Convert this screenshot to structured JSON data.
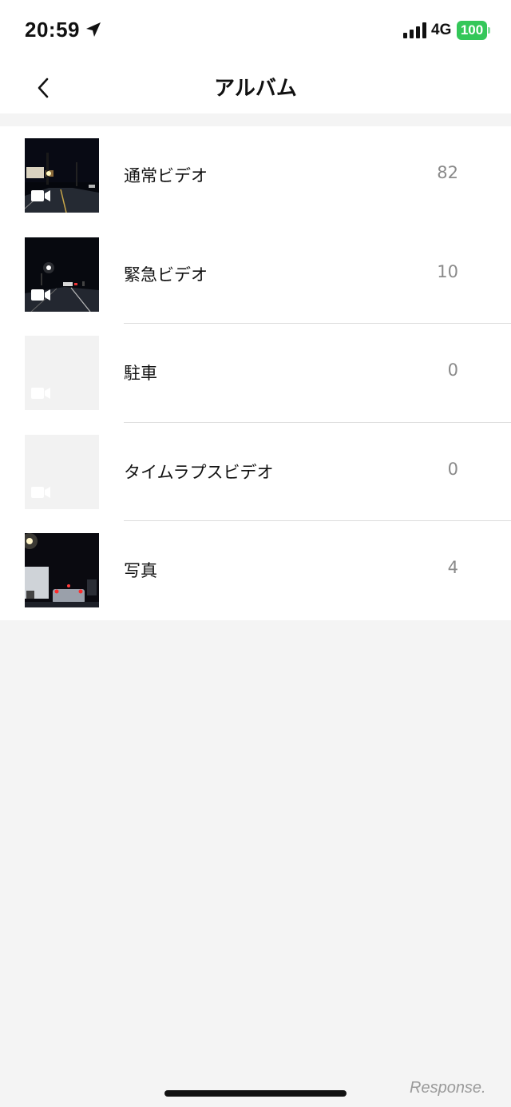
{
  "status_bar": {
    "time": "20:59",
    "network": "4G",
    "battery": "100",
    "location_icon": "location-arrow-icon",
    "signal_icon": "signal-bars-icon",
    "battery_color": "#34c759"
  },
  "header": {
    "title": "アルバム",
    "back_icon": "chevron-left-icon"
  },
  "albums": [
    {
      "label": "通常ビデオ",
      "count": "82",
      "thumbnail": "night-road-photo",
      "icon": "video-camera-icon"
    },
    {
      "label": "緊急ビデオ",
      "count": "10",
      "thumbnail": "night-road-photo",
      "icon": "video-camera-icon"
    },
    {
      "label": "駐車",
      "count": "0",
      "thumbnail": "empty-placeholder",
      "icon": "video-camera-icon"
    },
    {
      "label": "タイムラプスビデオ",
      "count": "0",
      "thumbnail": "empty-placeholder",
      "icon": "video-camera-icon"
    },
    {
      "label": "写真",
      "count": "4",
      "thumbnail": "night-traffic-photo"
    }
  ],
  "watermark": "Response."
}
